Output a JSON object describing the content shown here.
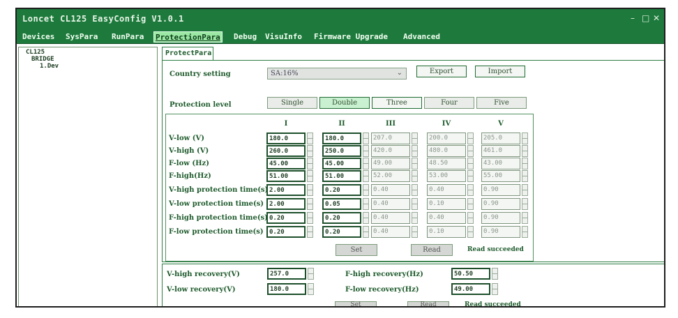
{
  "window": {
    "title": "Loncet CL125 EasyConfig V1.0.1",
    "controls": [
      "–",
      "□",
      "✕"
    ]
  },
  "menu": [
    {
      "label": "Devices",
      "active": false
    },
    {
      "label": "SysPara",
      "active": false
    },
    {
      "label": "RunPara",
      "active": false
    },
    {
      "label": "ProtectionPara",
      "active": true
    },
    {
      "label": "Debug",
      "active": false
    },
    {
      "label": "VisuInfo",
      "active": false
    },
    {
      "label": "Firmware Upgrade",
      "active": false
    },
    {
      "label": "Advanced",
      "active": false
    }
  ],
  "tree": {
    "root": "CL125",
    "child": "BRIDGE",
    "leaf": "1.Dev"
  },
  "tab": {
    "label": "ProtectPara"
  },
  "country": {
    "label": "Country setting",
    "value": "SA:16%",
    "export_label": "Export",
    "import_label": "Import"
  },
  "protection": {
    "label": "Protection level",
    "levels": [
      "Single",
      "Double",
      "Three",
      "Four",
      "Five"
    ],
    "active_level": 1,
    "columns": [
      "I",
      "II",
      "III",
      "IV",
      "V"
    ],
    "rows": [
      {
        "label": "V-low (V)",
        "values": [
          "180.0",
          "180.0",
          "207.0",
          "200.0",
          "205.0"
        ]
      },
      {
        "label": "V-high (V)",
        "values": [
          "260.0",
          "250.0",
          "420.0",
          "480.0",
          "461.0"
        ]
      },
      {
        "label": "F-low (Hz)",
        "values": [
          "45.00",
          "45.00",
          "49.00",
          "48.50",
          "43.00"
        ]
      },
      {
        "label": "F-high(Hz)",
        "values": [
          "51.00",
          "51.00",
          "52.00",
          "53.00",
          "55.00"
        ]
      },
      {
        "label": "V-high protection time(s)",
        "values": [
          "2.00",
          "0.20",
          "0.40",
          "0.40",
          "0.90"
        ]
      },
      {
        "label": "V-low protection time(s)",
        "values": [
          "2.00",
          "0.05",
          "0.40",
          "0.10",
          "0.90"
        ]
      },
      {
        "label": "F-high protection time(s)",
        "values": [
          "0.20",
          "0.20",
          "0.40",
          "0.40",
          "0.90"
        ]
      },
      {
        "label": "F-low protection time(s)",
        "values": [
          "0.20",
          "0.20",
          "0.40",
          "0.10",
          "0.90"
        ]
      }
    ],
    "active_columns": 2,
    "set_label": "Set",
    "read_label": "Read",
    "status": "Read succeeded"
  },
  "recovery": {
    "vhigh_label": "V-high recovery(V)",
    "vhigh_value": "257.0",
    "vlow_label": "V-low recovery(V)",
    "vlow_value": "180.0",
    "fhigh_label": "F-high recovery(Hz)",
    "fhigh_value": "50.50",
    "flow_label": "F-low recovery(Hz)",
    "flow_value": "49.00",
    "set_label": "Set",
    "read_label": "Read",
    "status": "Read succeeded"
  },
  "colors": {
    "titlebar": "#1d7a3c",
    "menu_active": "#9be8a4",
    "panel_border": "#2c7d42"
  }
}
